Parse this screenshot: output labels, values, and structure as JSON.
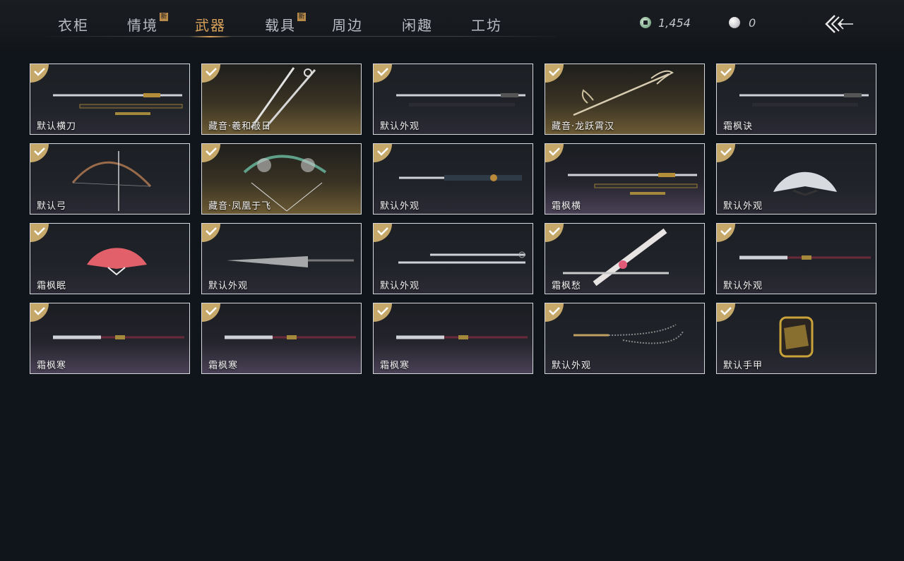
{
  "tabs": [
    {
      "label": "衣柜",
      "new": false,
      "active": false
    },
    {
      "label": "情境",
      "new": true,
      "active": false
    },
    {
      "label": "武器",
      "new": false,
      "active": true
    },
    {
      "label": "载具",
      "new": true,
      "active": false
    },
    {
      "label": "周边",
      "new": false,
      "active": false
    },
    {
      "label": "闲趣",
      "new": false,
      "active": false
    },
    {
      "label": "工坊",
      "new": false,
      "active": false
    }
  ],
  "new_badge_text": "新",
  "currency": {
    "coins": "1,454",
    "pearls": "0"
  },
  "items": [
    {
      "name": "默认横刀",
      "style": "default",
      "icon": "saber-icon"
    },
    {
      "name": "藏音·羲和敲日",
      "style": "gold",
      "icon": "crossed-spears-icon"
    },
    {
      "name": "默认外观",
      "style": "default",
      "icon": "sword-icon"
    },
    {
      "name": "藏音·龙跃霄汉",
      "style": "gold",
      "icon": "ornate-spear-icon"
    },
    {
      "name": "霜枫诀",
      "style": "default",
      "icon": "sword-icon"
    },
    {
      "name": "默认弓",
      "style": "default",
      "icon": "bow-icon"
    },
    {
      "name": "藏音·凤凰于飞",
      "style": "gold",
      "icon": "phoenix-bow-icon"
    },
    {
      "name": "默认外观",
      "style": "default",
      "icon": "dual-blades-icon"
    },
    {
      "name": "霜枫横",
      "style": "purple",
      "icon": "saber-icon"
    },
    {
      "name": "默认外观",
      "style": "default",
      "icon": "fan-icon"
    },
    {
      "name": "霜枫眠",
      "style": "default",
      "icon": "red-fan-icon"
    },
    {
      "name": "默认外观",
      "style": "default",
      "icon": "umbrella-icon"
    },
    {
      "name": "默认外观",
      "style": "default",
      "icon": "twin-swords-icon"
    },
    {
      "name": "霜枫愁",
      "style": "default",
      "icon": "diagonal-sword-icon"
    },
    {
      "name": "默认外观",
      "style": "default",
      "icon": "glaive-icon"
    },
    {
      "name": "霜枫寒",
      "style": "purple",
      "icon": "glaive-icon"
    },
    {
      "name": "霜枫寒",
      "style": "purple",
      "icon": "glaive-icon"
    },
    {
      "name": "霜枫寒",
      "style": "purple",
      "icon": "glaive-icon"
    },
    {
      "name": "默认外观",
      "style": "default",
      "icon": "rope-dart-icon"
    },
    {
      "name": "默认手甲",
      "style": "default",
      "icon": "gauntlet-icon"
    }
  ],
  "colors": {
    "accent_gold": "#d9a25a",
    "check_badge": "#c6a96a",
    "background": "#10141b"
  }
}
